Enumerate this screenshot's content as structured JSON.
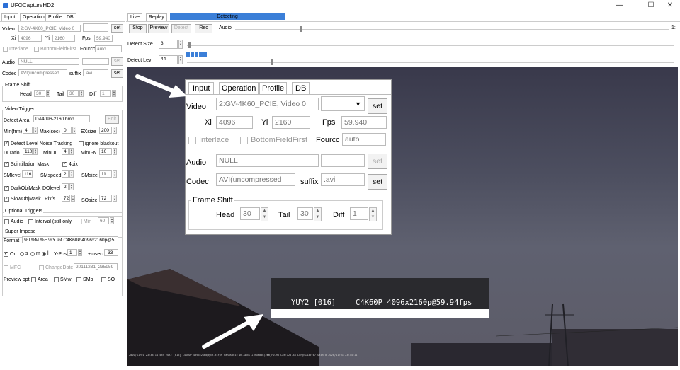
{
  "window": {
    "title": "UFOCaptureHD2",
    "minimize": "—",
    "maximize": "☐",
    "close": "✕"
  },
  "left_tabs": [
    "Input",
    "Operation",
    "Profile",
    "DB"
  ],
  "input": {
    "video_label": "Video",
    "video_value": "2:GV-4K60_PCIE, Video 0",
    "video_extra": "",
    "set": "set",
    "xi_label": "Xi",
    "xi": "4096",
    "yi_label": "Yi",
    "yi": "2160",
    "fps_label": "Fps",
    "fps": "59.940",
    "interlace": "Interlace",
    "bff": "BottomFieldFirst",
    "fourcc_label": "Fourcc",
    "fourcc": "auto",
    "audio_label": "Audio",
    "audio_value": "NULL",
    "codec_label": "Codec",
    "codec_value": "AVI(uncompressed",
    "suffix_label": "suffix",
    "suffix": ".avi"
  },
  "frame_shift": {
    "title": "Frame Shift",
    "head_label": "Head",
    "head": "30",
    "tail_label": "Tail",
    "tail": "30",
    "diff_label": "Diff",
    "diff": "1"
  },
  "video_trigger": {
    "title": "Video Trigger",
    "detect_area_label": "Detect Area",
    "detect_area": "DA4096-2160.bmp",
    "edit": "Edit",
    "minfrm_label": "Min(frm)",
    "minfrm": "4",
    "maxsec_label": "Max(sec)",
    "maxsec": "0",
    "exsize_label": "EXsize",
    "exsize": "200",
    "noise_tracking": "Detect Level Noise Tracking",
    "ignore_blackout": "ignore blackout",
    "dlratio_label": "DLratio",
    "dlratio": "110",
    "mindl_label": "MinDL",
    "mindl": "4",
    "minln_label": "MinL-N",
    "minln": "10",
    "scint_mask": "Scintillation Mask",
    "fourpix": "4pix",
    "smlevel_label": "SMlevel",
    "smlevel": "116",
    "smspeed_label": "SMspeed",
    "smspeed": "2",
    "smsize_label": "SMsize",
    "smsize": "11",
    "darkobjmask": "DarkObjMask",
    "dolevel_label": "DOlevel",
    "dolevel": "2",
    "slowobjmask": "SlowObjMask",
    "pixs_label": "Pix/s",
    "pixs": "72",
    "sosize_label": "SOsize",
    "sosize": "72"
  },
  "optional_triggers": {
    "title": "Optional Triggers",
    "audio": "Audio",
    "interval": "Interval (still only",
    "min_label": "] Min",
    "min": "60"
  },
  "super_impose": {
    "title": "Super Impose",
    "format_label": "Format",
    "format": "%T%M %F %Y %f   C4K60P 4096x2160p@5",
    "on": "On",
    "s": "s",
    "m": "m",
    "l": "l",
    "ypos_label": "Y-Pos",
    "ypos": "1",
    "msec_label": "+msec",
    "msec": "-33",
    "mfc": "MFC",
    "changedate": "ChangeDate",
    "changedate_value": "20111231_235959",
    "preview_label": "Preview opt",
    "area": "Area",
    "smw": "SMw",
    "smb": "SMb",
    "so": "SO"
  },
  "right": {
    "tabs": [
      "Live",
      "Replay"
    ],
    "status": "Detecting",
    "buttons": {
      "stop": "Stop",
      "preview": "Preview",
      "detect": "Detect",
      "rec": "Rec"
    },
    "audio_label": "Audio",
    "audio_end": "1:",
    "detect_size_label": "Detect Size",
    "detect_size": "3",
    "detect_lev_label": "Detect Lev",
    "detect_lev": "44",
    "level_bar": 0.32,
    "accent": "#3b7fd8"
  },
  "overlay": {
    "line1": "YUY2 [016]",
    "line2": "C4K60P 4096x2160p@59.94fps",
    "bottom_text": "2020/11/01 23:34:11.589      YUY2 [016]    C4K60P 4096x2160p@59.94fps    Panasonic DC-GH5s + mukaon(2mm)F0.95    Lat:+25.44 Long:+139.67  Gain:0  2020/11/01 23:34:11"
  },
  "icons": [
    "white-arrow-icon",
    "dropdown-arrow-icon",
    "spin-up-icon",
    "spin-down-icon"
  ]
}
